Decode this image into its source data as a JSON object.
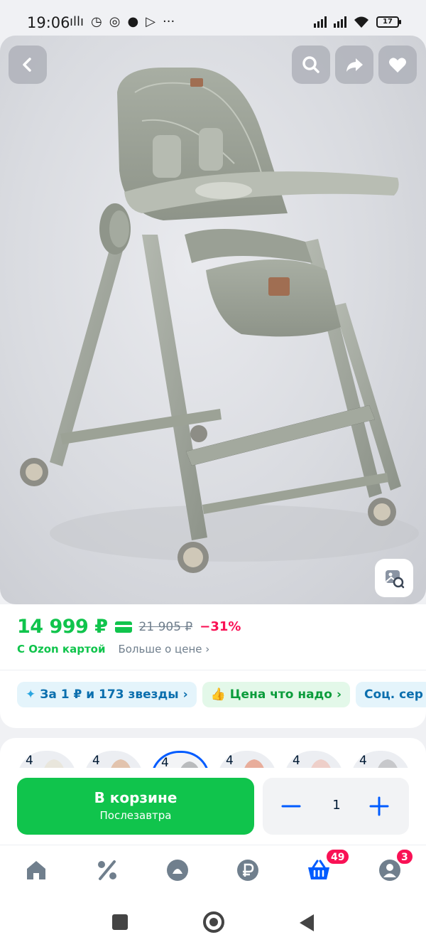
{
  "status_bar": {
    "time": "19:06",
    "battery": "17",
    "notification_icons": [
      "audio-wave-icon",
      "alarm-icon",
      "whatsapp-icon",
      "chat-icon",
      "play-store-icon",
      "more-dots-icon"
    ]
  },
  "hero": {
    "image_subject": "baby high chair, grey",
    "buttons": [
      "back-icon",
      "search-icon",
      "share-icon",
      "heart-icon"
    ],
    "visual_search_icon": "image-search-icon"
  },
  "price": {
    "current": "14 999 ₽",
    "old": "21 905 ₽",
    "discount": "−31%",
    "ozon_card_label": "С Ozon картой",
    "more_label": "Больше о цене",
    "accent": "#10c44c",
    "discount_color": "#f91155"
  },
  "chips": [
    {
      "label": "За 1 ₽ и 173 звезды",
      "icon": "sparkle-icon"
    },
    {
      "label": "Цена что надо",
      "icon": "thumbs-up-icon"
    },
    {
      "label": "Соц. сер",
      "icon": ""
    }
  ],
  "variants": {
    "labels": [
      "4",
      "4",
      "4",
      "4",
      "4",
      "4"
    ],
    "selected_index": 2,
    "colors": [
      "#e9e6dc",
      "#e8d2c2",
      "#b9bbbd",
      "#eab8a8",
      "#eed4cf",
      "#c7c8cb"
    ]
  },
  "cart": {
    "title": "В корзине",
    "subtitle": "Послезавтра",
    "quantity": "1"
  },
  "tabbar": {
    "tabs": [
      "home-icon",
      "percent-icon",
      "fresh-icon",
      "ruble-icon",
      "cart-icon",
      "profile-icon"
    ],
    "active": "cart-icon",
    "cart_badge": "49",
    "profile_badge": "3"
  }
}
